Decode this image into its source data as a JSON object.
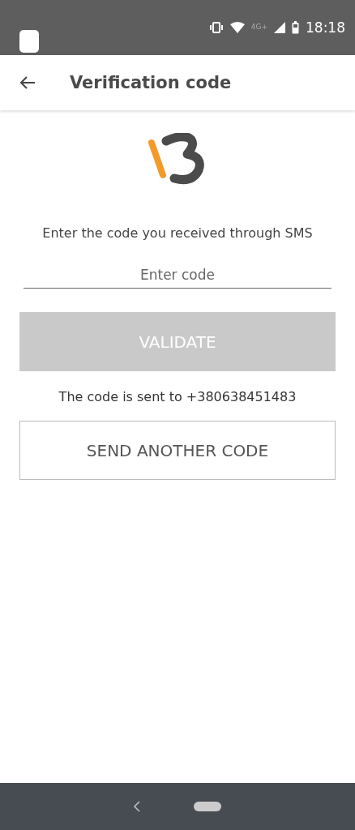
{
  "status_bar": {
    "time": "18:18",
    "network": "4G+"
  },
  "app_bar": {
    "title": "Verification code"
  },
  "instruction": "Enter the code you received through SMS",
  "code_field": {
    "placeholder": "Enter code"
  },
  "validate_button": {
    "label": "VALIDATE",
    "disabled": true
  },
  "sent_to": "The code is sent to +380638451483",
  "resend_button": {
    "label": "SEND ANOTHER CODE"
  }
}
